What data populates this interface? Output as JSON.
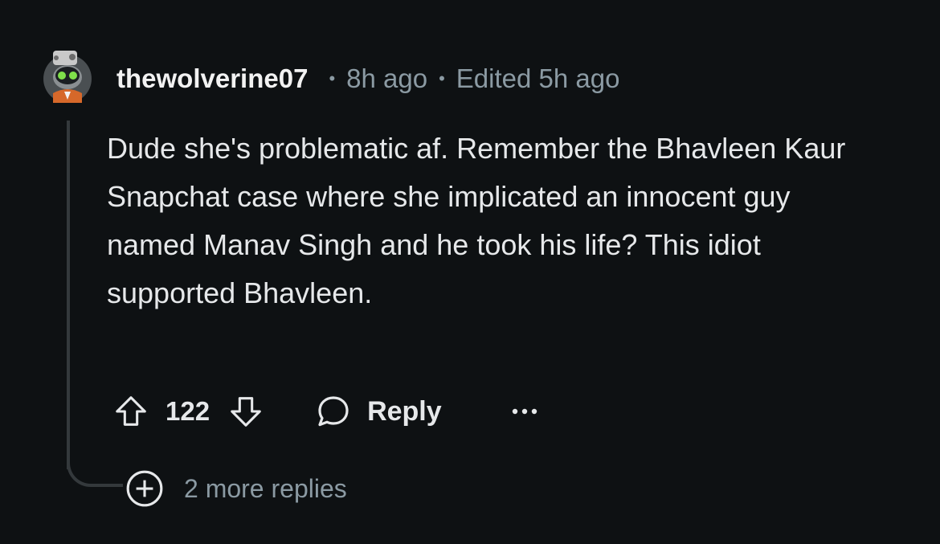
{
  "comment": {
    "username": "thewolverine07",
    "separator": "•",
    "time_ago": "8h ago",
    "edited": "Edited 5h ago",
    "body": "Dude she's problematic af. Remember the Bhavleen Kaur Snapchat case where she implicated an innocent guy named Manav Singh and he took his life? This idiot supported Bhavleen.",
    "avatar_icon": "avatar-icon",
    "votes": {
      "score": "122",
      "upvote_icon": "arrow-up-icon",
      "downvote_icon": "arrow-down-icon"
    },
    "reply": {
      "label": "Reply",
      "icon": "speech-bubble-icon"
    },
    "more_icon": "ellipsis-icon",
    "more_replies": {
      "label": "2 more replies",
      "icon": "plus-circle-icon"
    }
  },
  "colors": {
    "background": "#0e1113",
    "text_primary": "#e6e8ea",
    "text_muted": "#8b9aa3",
    "thread_line": "#34393c"
  }
}
